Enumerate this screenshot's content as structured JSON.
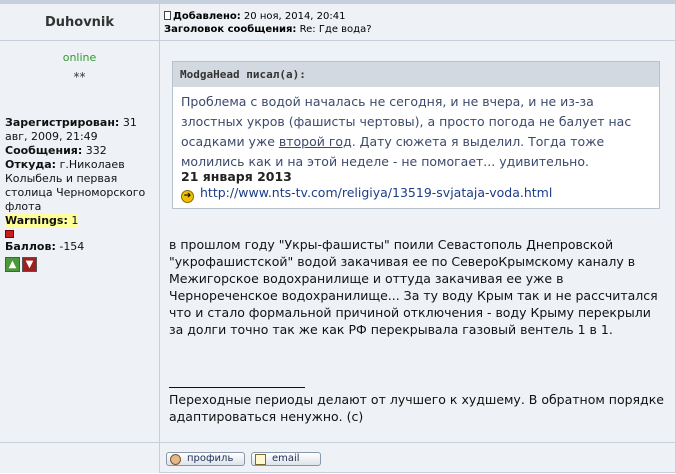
{
  "author": {
    "name": "Duhovnik",
    "status": "online",
    "rank": "**",
    "registered_label": "Зарегистрирован:",
    "registered_value": "31 авг, 2009, 21:49",
    "posts_label": "Сообщения:",
    "posts_value": "332",
    "from_label": "Откуда:",
    "from_value": "г.Николаев Колыбель и первая столица Черноморского флота",
    "warnings_label": "Warnings:",
    "warnings_value": "1",
    "score_label": "Баллов:",
    "score_value": "-154",
    "rate_plus_icon": "thumbs-up-icon",
    "rate_minus_icon": "thumbs-down-icon"
  },
  "post": {
    "added_label": "Добавлено:",
    "added_value": "20 ноя, 2014, 20:41",
    "subject_label": "Заголовок сообщения:",
    "subject_value": "Re: Где вода?",
    "quote": {
      "author_header": "ModgaHead писал(а):",
      "text_part1": "Проблема с водой началась не сегодня, и не вчера, и не из-за злостных укров (фашисты чертовы), а просто погода не балует нас осадками уже ",
      "text_underlined": "второй год",
      "text_part2": ". Дату сюжета я выделил. Тогда тоже молились как и на этой неделе - не помогает... удивительно.",
      "date": "21 января 2013",
      "link": "http://www.nts-tv.com/religiya/13519-svjataja-voda.html"
    },
    "body": "в прошлом году \"Укры-фашисты\" поили Севастополь Днепровской \"укрофашистской\" водой закачивая ее по СевероКрымскому каналу в Межигорское водохранилище и оттуда закачивая ее уже в Чернореченское водохранилище... За ту воду Крым так и не рассчитался что и стало формальной причиной отключения - воду Крыму перекрыли за долги точно так же как РФ перекрывала газовый вентель 1 в 1.",
    "signature": "Переходные периоды делают от лучшего к худшему. В обратном порядке адаптироваться ненужно. (с)"
  },
  "buttons": {
    "profile_label": "профиль",
    "email_label": "email"
  },
  "colors": {
    "online": "#2d9a2d",
    "link": "#1d3c8a",
    "quote_text": "#3b4a6b",
    "warning_highlight": "#ffff9a"
  }
}
